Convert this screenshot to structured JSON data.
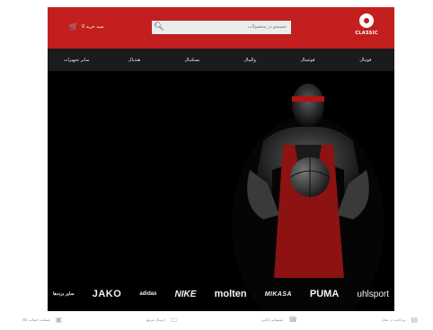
{
  "header": {
    "logo_text": "CLASSIC",
    "search_placeholder": "جستجو در محصولات",
    "cart_label": "0 سبد خرید"
  },
  "nav": {
    "items": [
      "فوتبال",
      "فوتسال",
      "والیبال",
      "بسکتبال",
      "هندبال",
      "سایر تجهیزات"
    ]
  },
  "brands": {
    "items": [
      "uhlsport",
      "PUMA",
      "MIKASA",
      "molten",
      "NIKE",
      "adidas",
      "JAKO",
      "سایر برندها"
    ]
  },
  "footer": {
    "features": [
      "ضمانت اصالت کالا",
      "ارسال سریع",
      "پشتیبانی آنلاین",
      "پرداخت در محل"
    ]
  },
  "colors": {
    "primary_red": "#c41f1f",
    "nav_dark": "#1b1b1b",
    "hero_bg": "#000000"
  }
}
